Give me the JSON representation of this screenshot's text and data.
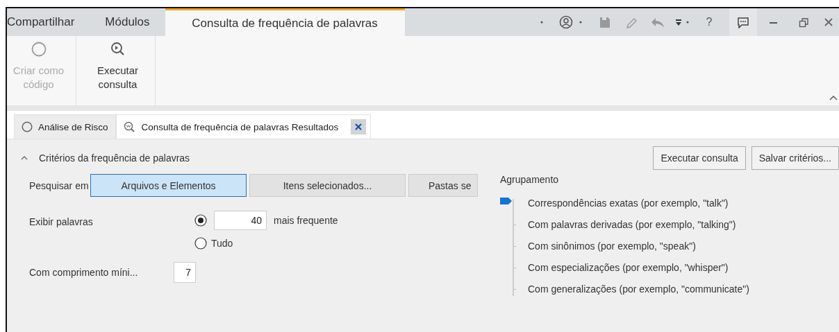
{
  "ribbon_tabs": [
    {
      "label": "Compartilhar",
      "selected": false
    },
    {
      "label": "Módulos",
      "selected": false
    },
    {
      "label": "Consulta de frequência de palavras",
      "selected": true
    }
  ],
  "title_bar": {
    "help_label": "?"
  },
  "ribbon_buttons": [
    {
      "label": "Criar como código",
      "disabled": true,
      "kind": "circle"
    },
    {
      "label": "Executar consulta",
      "disabled": false,
      "kind": "run"
    }
  ],
  "document_tabs": [
    {
      "label": "Análise de Risco",
      "selected": false,
      "kind": "circle",
      "closable": false
    },
    {
      "label": "Consulta de frequência de palavras Resultados",
      "selected": true,
      "kind": "query",
      "closable": true
    }
  ],
  "criteria": {
    "title": "Critérios da frequência de palavras",
    "expanded": true,
    "actions": [
      "Executar consulta",
      "Salvar critérios..."
    ],
    "search_in": {
      "label": "Pesquisar em",
      "options": [
        {
          "label": "Arquivos e Elementos",
          "selected": true
        },
        {
          "label": "Itens selecionados...",
          "selected": false
        },
        {
          "label": "Pastas se",
          "selected": false
        }
      ]
    },
    "display_words": {
      "label": "Exibir palavras",
      "options": [
        {
          "kind": "count",
          "selected": true,
          "value": "40",
          "suffix": "mais frequente"
        },
        {
          "kind": "all",
          "selected": false,
          "label": "Tudo"
        }
      ]
    },
    "min_length": {
      "label": "Com comprimento míni...",
      "value": "7"
    },
    "grouping": {
      "label": "Agrupamento",
      "options": [
        {
          "label": "Correspondências exatas (por exemplo, \"talk\")",
          "selected": true
        },
        {
          "label": "Com palavras derivadas (por exemplo, \"talking\")",
          "selected": false
        },
        {
          "label": "Com sinônimos (por exemplo, \"speak\")",
          "selected": false
        },
        {
          "label": "Com especializações (por exemplo, \"whisper\")",
          "selected": false
        },
        {
          "label": "Com generalizações (por exemplo, \"communicate\")",
          "selected": false
        }
      ]
    }
  }
}
